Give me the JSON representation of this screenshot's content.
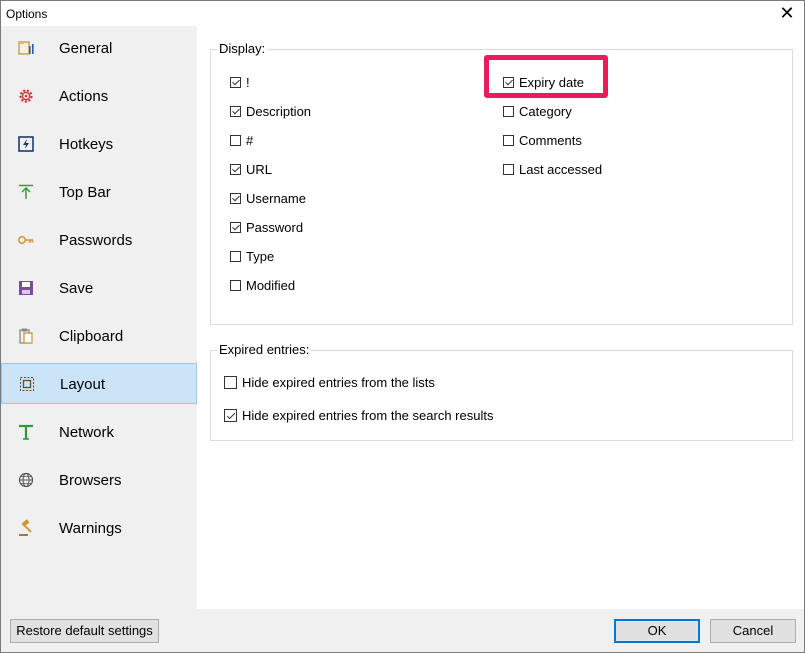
{
  "window": {
    "title": "Options",
    "close_glyph": "✕"
  },
  "sidebar": {
    "items": [
      {
        "label": "General",
        "icon": "general-icon"
      },
      {
        "label": "Actions",
        "icon": "gear-icon"
      },
      {
        "label": "Hotkeys",
        "icon": "lightning-icon"
      },
      {
        "label": "Top Bar",
        "icon": "arrow-up-icon"
      },
      {
        "label": "Passwords",
        "icon": "key-icon"
      },
      {
        "label": "Save",
        "icon": "floppy-disk-icon"
      },
      {
        "label": "Clipboard",
        "icon": "clipboard-icon"
      },
      {
        "label": "Layout",
        "icon": "layout-icon",
        "selected": true
      },
      {
        "label": "Network",
        "icon": "network-icon"
      },
      {
        "label": "Browsers",
        "icon": "globe-icon"
      },
      {
        "label": "Warnings",
        "icon": "gavel-icon"
      }
    ]
  },
  "display": {
    "legend": "Display:",
    "left_column": [
      {
        "label": "!",
        "checked": true
      },
      {
        "label": "Description",
        "checked": true
      },
      {
        "label": "#",
        "checked": false
      },
      {
        "label": "URL",
        "checked": true
      },
      {
        "label": "Username",
        "checked": true
      },
      {
        "label": "Password",
        "checked": true
      },
      {
        "label": "Type",
        "checked": false
      },
      {
        "label": "Modified",
        "checked": false
      }
    ],
    "right_column": [
      {
        "label": "Expiry date",
        "checked": true
      },
      {
        "label": "Category",
        "checked": false
      },
      {
        "label": "Comments",
        "checked": false
      },
      {
        "label": "Last accessed",
        "checked": false
      }
    ]
  },
  "expired": {
    "legend": "Expired entries:",
    "options": [
      {
        "label": "Hide expired entries from the lists",
        "checked": false
      },
      {
        "label": "Hide expired entries from the search results",
        "checked": true
      }
    ]
  },
  "footer": {
    "restore_label": "Restore default settings",
    "ok_label": "OK",
    "cancel_label": "Cancel"
  },
  "colors": {
    "highlight": "#ea1c5c",
    "selected_bg": "#cce4f7",
    "selected_border": "#99c9ef"
  }
}
